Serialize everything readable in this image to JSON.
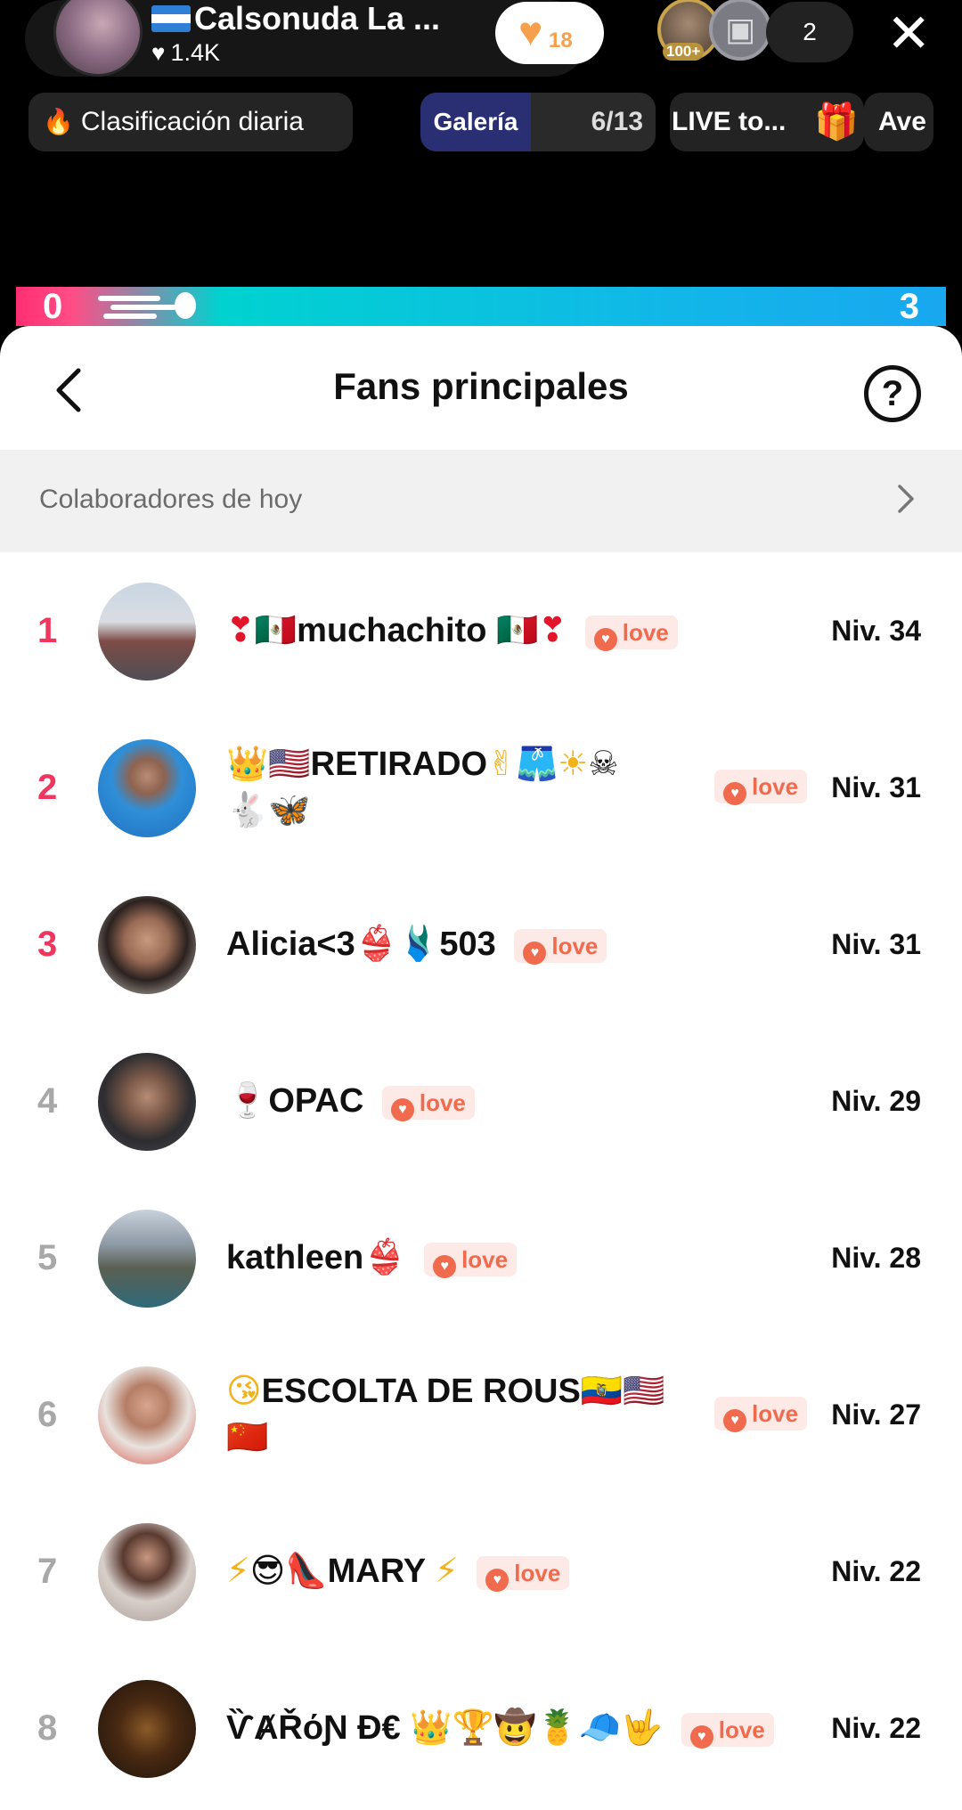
{
  "host": {
    "name": "Calsonuda La ...",
    "likes": "1.4K",
    "action_count": "18"
  },
  "viewers": {
    "badge": "100+",
    "count": "2"
  },
  "chips": {
    "ranking": "Clasificación diaria",
    "gallery_label": "Galería",
    "gallery_count": "6/13",
    "live": "LIVE to...",
    "ave": "Ave"
  },
  "progress": {
    "start": "0",
    "end": "3",
    "level_fraction": 0.12
  },
  "sheet": {
    "title": "Fans principales",
    "today_label": "Colaboradores de hoy",
    "help_symbol": "?"
  },
  "badge_label": "love",
  "fans": [
    {
      "rank": "1",
      "name": "muchachito",
      "level": "Niv. 34"
    },
    {
      "rank": "2",
      "name": "RETIRADO",
      "level": "Niv. 31"
    },
    {
      "rank": "3",
      "name": "Alicia<3",
      "name_suffix": "503",
      "level": "Niv. 31"
    },
    {
      "rank": "4",
      "name": "OPAC",
      "level": "Niv. 29"
    },
    {
      "rank": "5",
      "name": "kathleen",
      "level": "Niv. 28"
    },
    {
      "rank": "6",
      "name": "ESCOLTA DE ROUS",
      "level": "Niv. 27"
    },
    {
      "rank": "7",
      "name": "MARY",
      "level": "Niv. 22"
    },
    {
      "rank": "8",
      "name": "ѶȺŘόƝ Đ€",
      "level": "Niv. 22"
    }
  ],
  "colors": {
    "top_rank": "#f0365f",
    "other_rank": "#a8a8a8",
    "love_badge_text": "#f06a4d",
    "love_badge_bg": "#fde9e6",
    "progress_start": "#ff2e72",
    "progress_end": "#19a7f0"
  }
}
